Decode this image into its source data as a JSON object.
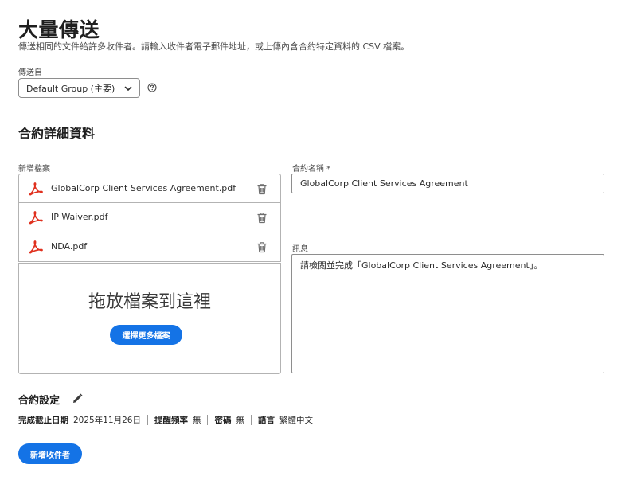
{
  "page": {
    "title": "大量傳送",
    "subtitle": "傳送相同的文件給許多收件者。請輸入收件者電子郵件地址，或上傳內含合約特定資料的 CSV 檔案。"
  },
  "sender": {
    "label": "傳送自",
    "selected": "Default Group (主要)"
  },
  "agreement_details": {
    "section_title": "合約詳細資料",
    "files_label": "新增檔案",
    "files": [
      {
        "name": "GlobalCorp Client Services Agreement.pdf",
        "icon": "pdf-icon"
      },
      {
        "name": "IP Waiver.pdf",
        "icon": "pdf-icon"
      },
      {
        "name": "NDA.pdf",
        "icon": "pdf-icon"
      }
    ],
    "dropzone_text": "拖放檔案到這裡",
    "select_more_label": "選擇更多檔案",
    "name_label": "合約名稱 *",
    "name_value": "GlobalCorp Client Services Agreement",
    "message_label": "訊息",
    "message_value": "請檢閱並完成「GlobalCorp Client Services Agreement」。"
  },
  "settings": {
    "title": "合約設定",
    "deadline_label": "完成截止日期",
    "deadline_value": "2025年11月26日",
    "reminder_label": "提醒頻率",
    "reminder_value": "無",
    "password_label": "密碼",
    "password_value": "無",
    "language_label": "語言",
    "language_value": "繁體中文"
  },
  "actions": {
    "add_recipient_label": "新增收件者"
  },
  "colors": {
    "accent": "#1473e6",
    "pdf_red": "#e0301e"
  }
}
